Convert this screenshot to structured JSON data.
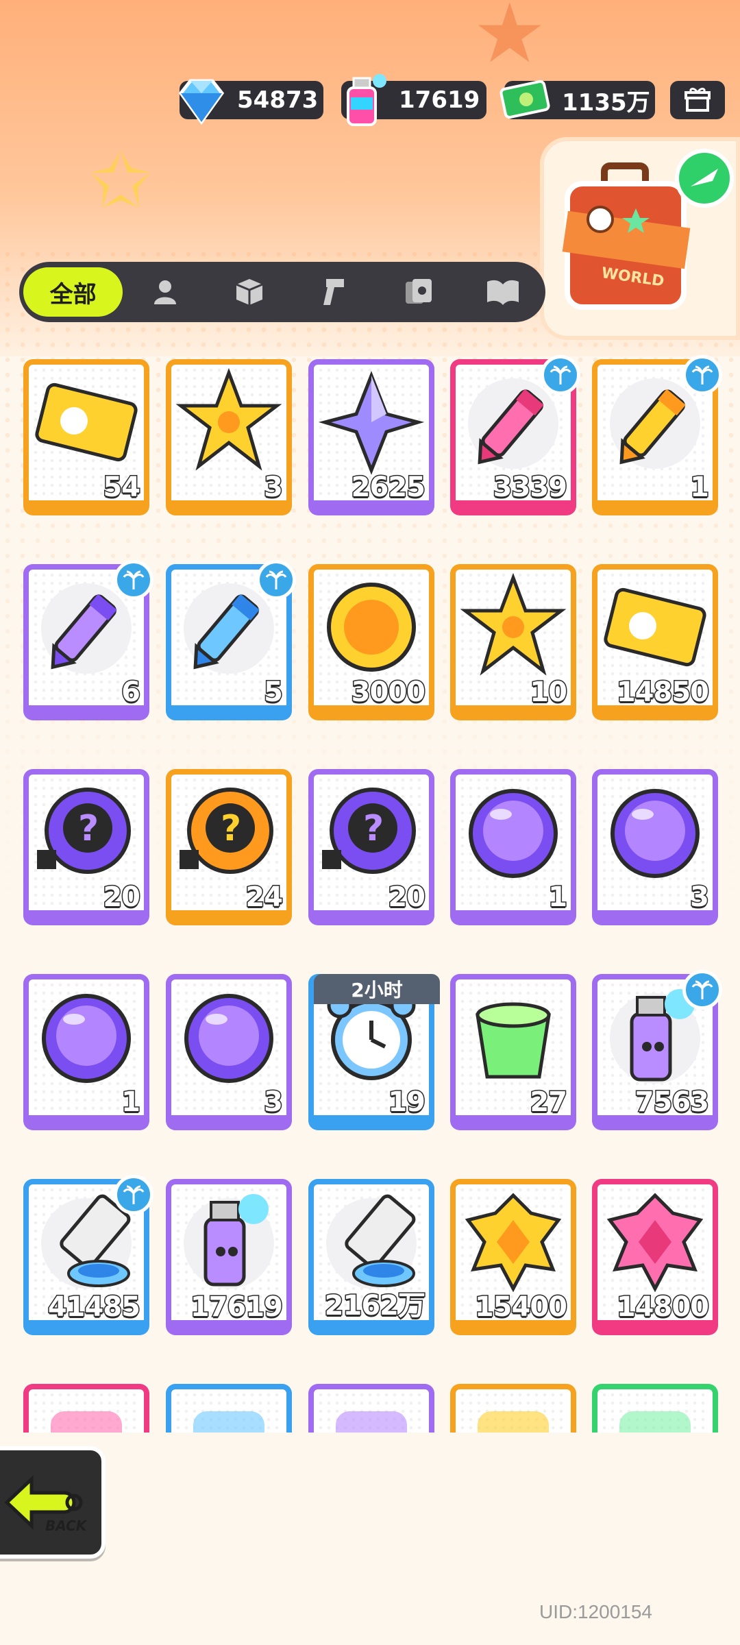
{
  "currencies": [
    {
      "name": "diamond",
      "value": "54873",
      "icon": "diamond-icon"
    },
    {
      "name": "spray",
      "value": "17619",
      "icon": "spray-can-icon"
    },
    {
      "name": "cash",
      "value": "1135万",
      "icon": "cash-icon"
    }
  ],
  "shop_icon": "gift-shop-icon",
  "tabs": {
    "active_label": "全部",
    "icons": [
      "character-icon",
      "box-icon",
      "weapon-icon",
      "cards-icon",
      "book-icon"
    ]
  },
  "items": [
    {
      "qty": "54",
      "color": "orange",
      "icon": "ticket-icon"
    },
    {
      "qty": "3",
      "color": "orange",
      "icon": "rainbow-star-icon"
    },
    {
      "qty": "2625",
      "color": "purple",
      "icon": "purple-crystal-icon"
    },
    {
      "qty": "3339",
      "color": "pink",
      "icon": "pink-crayon-icon",
      "badge": true
    },
    {
      "qty": "1",
      "color": "orange",
      "icon": "yellow-crayon-icon",
      "badge": true
    },
    {
      "qty": "6",
      "color": "purple",
      "icon": "purple-crayon-icon",
      "badge": true
    },
    {
      "qty": "5",
      "color": "blue",
      "icon": "blue-crayon-icon",
      "badge": true
    },
    {
      "qty": "3000",
      "color": "orange",
      "icon": "cool-badge-icon"
    },
    {
      "qty": "10",
      "color": "orange",
      "icon": "star-badge-icon"
    },
    {
      "qty": "14850",
      "color": "orange",
      "icon": "season-ticket-icon"
    },
    {
      "qty": "20",
      "color": "purple",
      "icon": "mystery-egg-icon"
    },
    {
      "qty": "24",
      "color": "orange",
      "icon": "deity-mystery-icon"
    },
    {
      "qty": "20",
      "color": "purple",
      "icon": "deity-mystery-purple-icon"
    },
    {
      "qty": "1",
      "color": "purple",
      "icon": "fish-orb-icon"
    },
    {
      "qty": "3",
      "color": "purple",
      "icon": "monster-orb-icon"
    },
    {
      "qty": "1",
      "color": "purple",
      "icon": "squid-orb-icon"
    },
    {
      "qty": "3",
      "color": "purple",
      "icon": "sprout-orb-icon"
    },
    {
      "qty": "19",
      "color": "blue",
      "icon": "alarm-clock-icon",
      "timer": "2小时"
    },
    {
      "qty": "27",
      "color": "purple",
      "icon": "open-jelly-icon"
    },
    {
      "qty": "7563",
      "color": "purple",
      "icon": "blue-spray-icon",
      "badge": true
    },
    {
      "qty": "41485",
      "color": "blue",
      "icon": "paint-tube-rainbow-icon",
      "badge": true
    },
    {
      "qty": "17619",
      "color": "purple",
      "icon": "pink-spray-icon"
    },
    {
      "qty": "2162万",
      "color": "blue",
      "icon": "paint-tube-purple-icon"
    },
    {
      "qty": "15400",
      "color": "orange",
      "icon": "gold-gem-icon"
    },
    {
      "qty": "14800",
      "color": "pink",
      "icon": "red-gem-icon"
    },
    {
      "qty": "",
      "color": "pink",
      "icon": "partial-item-icon"
    },
    {
      "qty": "",
      "color": "blue",
      "icon": "partial-item-icon"
    },
    {
      "qty": "",
      "color": "purple",
      "icon": "partial-item-icon"
    },
    {
      "qty": "",
      "color": "orange",
      "icon": "partial-item-icon"
    },
    {
      "qty": "",
      "color": "green",
      "icon": "partial-item-icon"
    }
  ],
  "back_label": "BACK",
  "uid": "UID:1200154"
}
